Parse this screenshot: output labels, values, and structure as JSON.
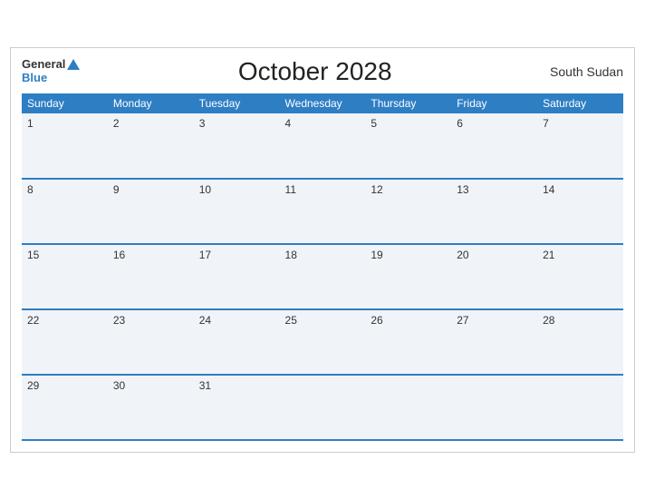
{
  "header": {
    "logo_general": "General",
    "logo_blue": "Blue",
    "title": "October 2028",
    "country": "South Sudan"
  },
  "days_of_week": [
    "Sunday",
    "Monday",
    "Tuesday",
    "Wednesday",
    "Thursday",
    "Friday",
    "Saturday"
  ],
  "weeks": [
    [
      "1",
      "2",
      "3",
      "4",
      "5",
      "6",
      "7"
    ],
    [
      "8",
      "9",
      "10",
      "11",
      "12",
      "13",
      "14"
    ],
    [
      "15",
      "16",
      "17",
      "18",
      "19",
      "20",
      "21"
    ],
    [
      "22",
      "23",
      "24",
      "25",
      "26",
      "27",
      "28"
    ],
    [
      "29",
      "30",
      "31",
      "",
      "",
      "",
      ""
    ]
  ],
  "colors": {
    "header_bg": "#2e7ec4",
    "row_bg": "#f0f4f8",
    "border": "#2e7ec4"
  }
}
